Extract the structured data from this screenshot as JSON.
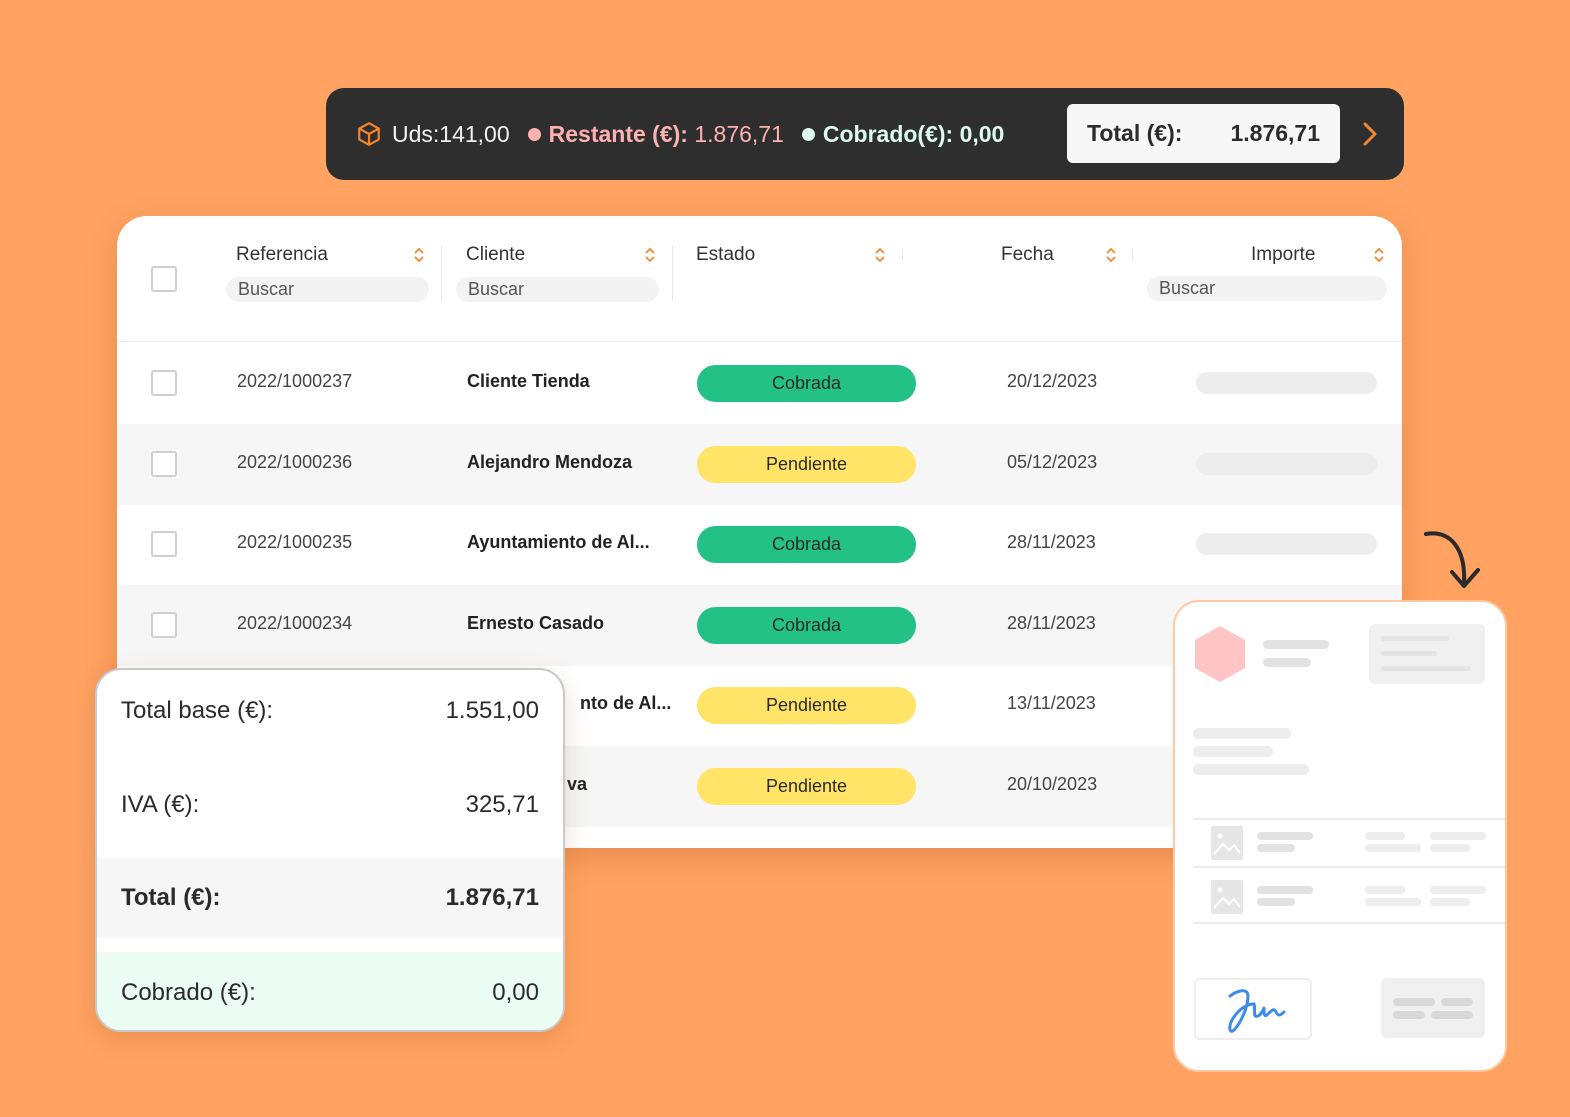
{
  "summary": {
    "uds": "Uds:141,00",
    "restante_label": "Restante (€):",
    "restante_value": "1.876,71",
    "cobrado": "Cobrado(€): 0,00",
    "total_label": "Total (€):",
    "total_value": "1.876,71",
    "colors": {
      "restante_dot": "#FFB1B1",
      "cobrado_dot": "#DDFBEF"
    }
  },
  "table": {
    "columns": {
      "referencia": "Referencia",
      "cliente": "Cliente",
      "estado": "Estado",
      "fecha": "Fecha",
      "importe": "Importe"
    },
    "search_placeholder": "Buscar",
    "rows": [
      {
        "ref": "2022/1000237",
        "client": "Cliente Tienda",
        "status": "Cobrada",
        "date": "20/12/2023"
      },
      {
        "ref": "2022/1000236",
        "client": "Alejandro Mendoza",
        "status": "Pendiente",
        "date": "05/12/2023"
      },
      {
        "ref": "2022/1000235",
        "client": "Ayuntamiento de Al...",
        "status": "Cobrada",
        "date": "28/11/2023"
      },
      {
        "ref": "2022/1000234",
        "client": "Ernesto Casado",
        "status": "Cobrada",
        "date": "28/11/2023"
      },
      {
        "ref": "",
        "client": "nto de Al...",
        "status": "Pendiente",
        "date": "13/11/2023"
      },
      {
        "ref": "",
        "client": "va",
        "status": "Pendiente",
        "date": "20/10/2023"
      }
    ],
    "status_colors": {
      "Cobrada": "#24C186",
      "Pendiente": "#FFE468"
    }
  },
  "totals": {
    "base_label": "Total base (€):",
    "base_value": "1.551,00",
    "iva_label": "IVA (€):",
    "iva_value": "325,71",
    "total_label": "Total (€):",
    "total_value": "1.876,71",
    "cobrado_label": "Cobrado (€):",
    "cobrado_value": "0,00"
  }
}
